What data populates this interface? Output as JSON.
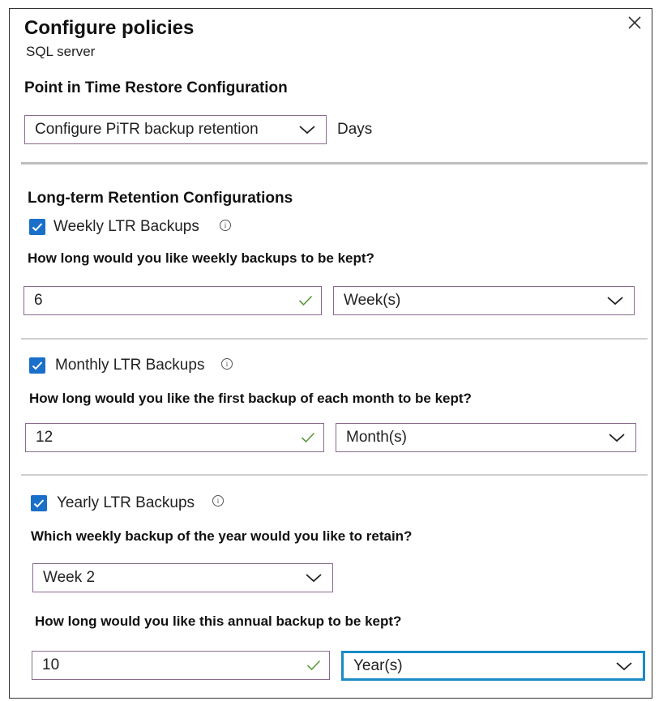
{
  "header": {
    "title": "Configure policies",
    "subtitle": "SQL server"
  },
  "pitr": {
    "section_title": "Point in Time Restore Configuration",
    "dropdown_value": "Configure PiTR backup retention",
    "unit_label": "Days"
  },
  "ltr": {
    "section_title": "Long-term Retention Configurations",
    "weekly": {
      "checkbox_label": "Weekly LTR Backups",
      "checked": true,
      "question": "How long would you like weekly backups to be kept?",
      "value": "6",
      "unit": "Week(s)"
    },
    "monthly": {
      "checkbox_label": "Monthly LTR Backups",
      "checked": true,
      "question": "How long would you like the first backup of each month to be kept?",
      "value": "12",
      "unit": "Month(s)"
    },
    "yearly": {
      "checkbox_label": "Yearly LTR Backups",
      "checked": true,
      "week_question": "Which weekly backup of the year would you like to retain?",
      "week_value": "Week 2",
      "duration_question": "How long would you like this annual backup to be kept?",
      "value": "10",
      "unit": "Year(s)"
    }
  },
  "colors": {
    "accent": "#1a6fc9",
    "focus_border": "#1a8bc4",
    "field_border": "#8a6b8e",
    "valid_check": "#5a9a3c"
  }
}
